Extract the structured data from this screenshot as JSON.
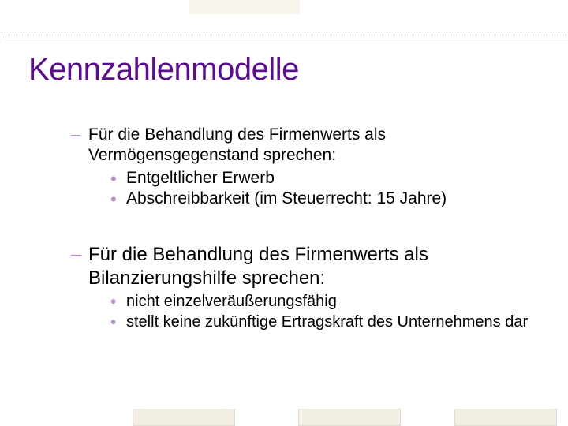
{
  "slide": {
    "title": "Kennzahlenmodelle",
    "blocks": [
      {
        "lead": "Für die Behandlung des Firmenwerts als Vermögensgegenstand sprechen:",
        "items": [
          "Entgeltlicher Erwerb",
          "Abschreibbarkeit (im Steuerrecht: 15 Jahre)"
        ]
      },
      {
        "lead": "Für die Behandlung des Firmenwerts als Bilanzierungshilfe sprechen:",
        "items": [
          "nicht einzelveräußerungsfähig",
          "stellt keine zukünftige Ertragskraft des Unternehmens dar"
        ]
      }
    ]
  }
}
